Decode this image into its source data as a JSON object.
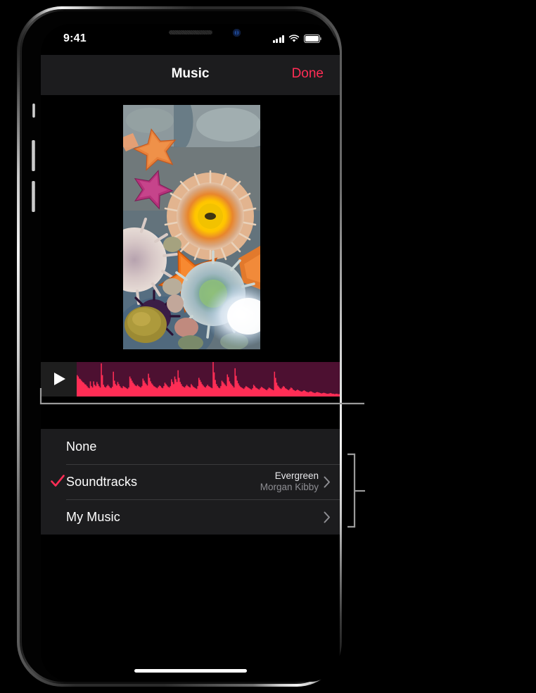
{
  "device": {
    "name": "iphone-x",
    "bezel_color": "#c9c9c9"
  },
  "status_bar": {
    "time": "9:41",
    "cellular_icon": "signal-bars-icon",
    "wifi_icon": "wifi-icon",
    "battery_icon": "battery-full-icon"
  },
  "nav_bar": {
    "title": "Music",
    "done_label": "Done",
    "accent_color": "#ff2d55",
    "background_color": "#1c1c1e"
  },
  "preview": {
    "name": "video-preview-thumbnail",
    "description": "tide pool with sea stars and anemones"
  },
  "audio_track": {
    "play_icon": "play-icon",
    "waveform_color": "#ff2d55",
    "waveform_background_color": "#4d1031",
    "waveform_peaks": [
      0.62,
      0.58,
      0.52,
      0.5,
      0.46,
      0.42,
      0.4,
      0.36,
      0.34,
      0.3,
      0.26,
      0.24,
      0.44,
      0.3,
      0.26,
      0.44,
      0.34,
      0.3,
      0.42,
      0.36,
      0.3,
      0.26,
      0.96,
      0.62,
      0.34,
      0.28,
      0.26,
      0.3,
      0.34,
      0.3,
      0.26,
      0.24,
      0.28,
      0.72,
      0.46,
      0.36,
      0.32,
      0.42,
      0.36,
      0.3,
      0.26,
      0.24,
      0.3,
      0.28,
      0.26,
      0.24,
      0.22,
      0.26,
      0.58,
      0.52,
      0.46,
      0.4,
      0.36,
      0.32,
      0.3,
      0.34,
      0.3,
      0.28,
      0.26,
      0.3,
      0.52,
      0.46,
      0.4,
      0.36,
      0.32,
      0.66,
      0.54,
      0.44,
      0.38,
      0.34,
      0.3,
      0.28,
      0.26,
      0.24,
      0.28,
      0.32,
      0.3,
      0.26,
      0.24,
      0.3,
      0.4,
      0.36,
      0.32,
      0.28,
      0.26,
      0.3,
      0.5,
      0.42,
      0.36,
      0.58,
      0.5,
      0.42,
      0.76,
      0.54,
      0.42,
      0.36,
      0.3,
      0.28,
      0.26,
      0.3,
      0.34,
      0.3,
      0.28,
      0.26,
      0.36,
      0.32,
      0.28,
      0.26,
      0.24,
      0.22,
      0.3,
      0.54,
      0.48,
      0.42,
      0.36,
      0.32,
      0.28,
      0.26,
      0.3,
      0.34,
      0.3,
      0.28,
      0.26,
      0.24,
      1.0,
      0.7,
      0.48,
      0.36,
      0.3,
      0.26,
      0.24,
      0.3,
      0.46,
      0.42,
      0.38,
      0.34,
      0.3,
      0.64,
      0.56,
      0.44,
      0.38,
      0.34,
      0.3,
      0.26,
      0.82,
      0.6,
      0.46,
      0.38,
      0.32,
      0.28,
      0.26,
      0.24,
      0.22,
      0.26,
      0.3,
      0.28,
      0.26,
      0.24,
      0.22,
      0.2,
      0.24,
      0.34,
      0.3,
      0.26,
      0.24,
      0.22,
      0.2,
      0.24,
      0.28,
      0.26,
      0.24,
      0.22,
      0.2,
      0.18,
      0.22,
      0.26,
      0.24,
      0.22,
      0.2,
      0.18,
      0.72,
      0.54,
      0.4,
      0.32,
      0.28,
      0.24,
      0.22,
      0.26,
      0.3,
      0.28,
      0.24,
      0.22,
      0.2,
      0.18,
      0.22,
      0.26,
      0.24,
      0.2,
      0.18,
      0.16,
      0.18,
      0.2,
      0.18,
      0.16,
      0.15,
      0.14,
      0.16,
      0.18,
      0.16,
      0.14,
      0.13,
      0.12,
      0.14,
      0.15,
      0.14,
      0.12,
      0.11,
      0.1,
      0.12,
      0.13,
      0.12,
      0.11,
      0.1,
      0.09,
      0.1,
      0.11,
      0.1,
      0.09,
      0.08,
      0.08,
      0.09,
      0.1,
      0.09,
      0.08,
      0.08,
      0.07,
      0.08,
      0.08,
      0.07,
      0.07
    ]
  },
  "options": {
    "items": [
      {
        "name": "none",
        "label": "None",
        "selected": false,
        "detail_title": "",
        "detail_subtitle": "",
        "has_chevron": false
      },
      {
        "name": "soundtracks",
        "label": "Soundtracks",
        "selected": true,
        "detail_title": "Evergreen",
        "detail_subtitle": "Morgan Kibby",
        "has_chevron": true
      },
      {
        "name": "my-music",
        "label": "My Music",
        "selected": false,
        "detail_title": "",
        "detail_subtitle": "",
        "has_chevron": true
      }
    ],
    "checkmark_color": "#ff2d55",
    "chevron_icon": "chevron-right-icon",
    "check_icon": "checkmark-icon"
  },
  "annotations": {
    "play_callout": "callout-leader-line-play-button",
    "list_bracket": "callout-bracket-music-options"
  },
  "home_indicator": "home-indicator"
}
